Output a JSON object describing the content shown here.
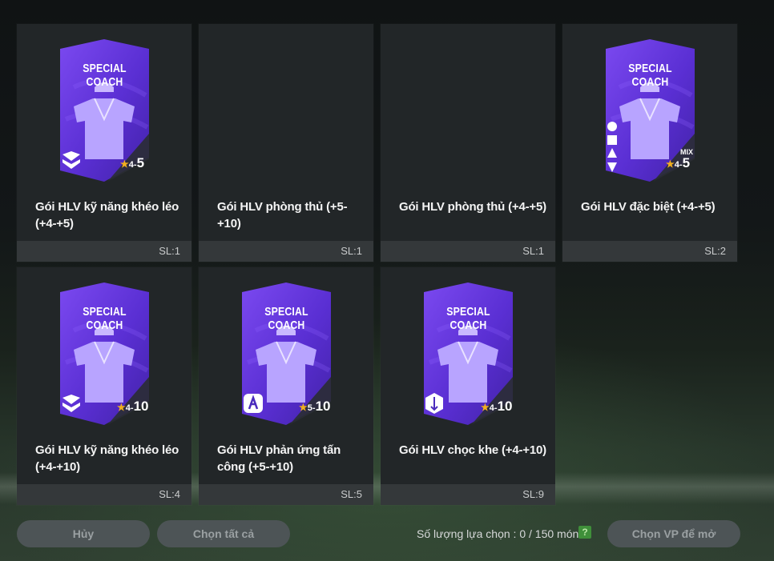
{
  "packs": [
    {
      "title": "Gói HLV kỹ năng khéo léo (+4-+5)",
      "count": "SL:1",
      "card": true,
      "card_label": "SPECIAL COACH",
      "rating_min": "4",
      "rating_sep": "-",
      "rating_max": "5",
      "icon": "dribble-skill-icon"
    },
    {
      "title": "Gói HLV phòng thủ (+5-+10)",
      "count": "SL:1",
      "card": false
    },
    {
      "title": "Gói HLV phòng thủ (+4-+5)",
      "count": "SL:1",
      "card": false
    },
    {
      "title": "Gói HLV đặc biệt (+4-+5)",
      "count": "SL:2",
      "card": true,
      "card_label": "SPECIAL COACH",
      "rating_min": "4",
      "rating_sep": "-",
      "rating_max": "5",
      "mix": "MIX",
      "icon": "mixed-skills-icon"
    },
    {
      "title": "Gói HLV kỹ năng khéo léo (+4-+10)",
      "count": "SL:4",
      "card": true,
      "card_label": "SPECIAL COACH",
      "rating_min": "4",
      "rating_sep": "-",
      "rating_max": "10",
      "icon": "dribble-skill-icon"
    },
    {
      "title": "Gói HLV phản ứng tấn công (+5-+10)",
      "count": "SL:5",
      "card": true,
      "card_label": "SPECIAL COACH",
      "rating_min": "5",
      "rating_sep": "-",
      "rating_max": "10",
      "icon": "attack-reaction-icon"
    },
    {
      "title": "Gói HLV chọc khe (+4-+10)",
      "count": "SL:9",
      "card": true,
      "card_label": "SPECIAL COACH",
      "rating_min": "4",
      "rating_sep": "-",
      "rating_max": "10",
      "icon": "through-pass-icon"
    }
  ],
  "footer": {
    "cancel_label": "Hủy",
    "select_all_label": "Chọn tất cả",
    "selection_label": "Số lượng lựa chọn : 0 / 150 món",
    "help_label": "?",
    "open_label": "Chọn VP để mở"
  },
  "colors": {
    "card_purple": "#6a3fe0",
    "star": "#f2b01e",
    "tile": "#222628",
    "button": "#4d5456"
  }
}
